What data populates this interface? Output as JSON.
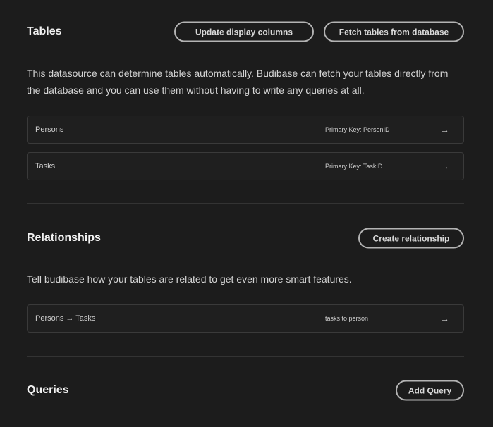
{
  "tables": {
    "title": "Tables",
    "update_button": "Update display columns",
    "fetch_button": "Fetch tables from database",
    "description": "This datasource can determine tables automatically. Budibase can fetch your tables directly from the database and you can use them without having to write any queries at all.",
    "rows": [
      {
        "name": "Persons",
        "meta": "Primary Key: PersonID",
        "arrow": "→"
      },
      {
        "name": "Tasks",
        "meta": "Primary Key: TaskID",
        "arrow": "→"
      }
    ]
  },
  "relationships": {
    "title": "Relationships",
    "create_button": "Create relationship",
    "description": "Tell budibase how your tables are related to get even more smart features.",
    "rows": [
      {
        "name": "Persons → Tasks",
        "meta": "tasks to person",
        "arrow": "→"
      }
    ]
  },
  "queries": {
    "title": "Queries",
    "add_button": "Add Query"
  },
  "colors": {
    "background": "#1c1c1c",
    "text": "#e6e6e6",
    "border": "#3a3a3a"
  }
}
